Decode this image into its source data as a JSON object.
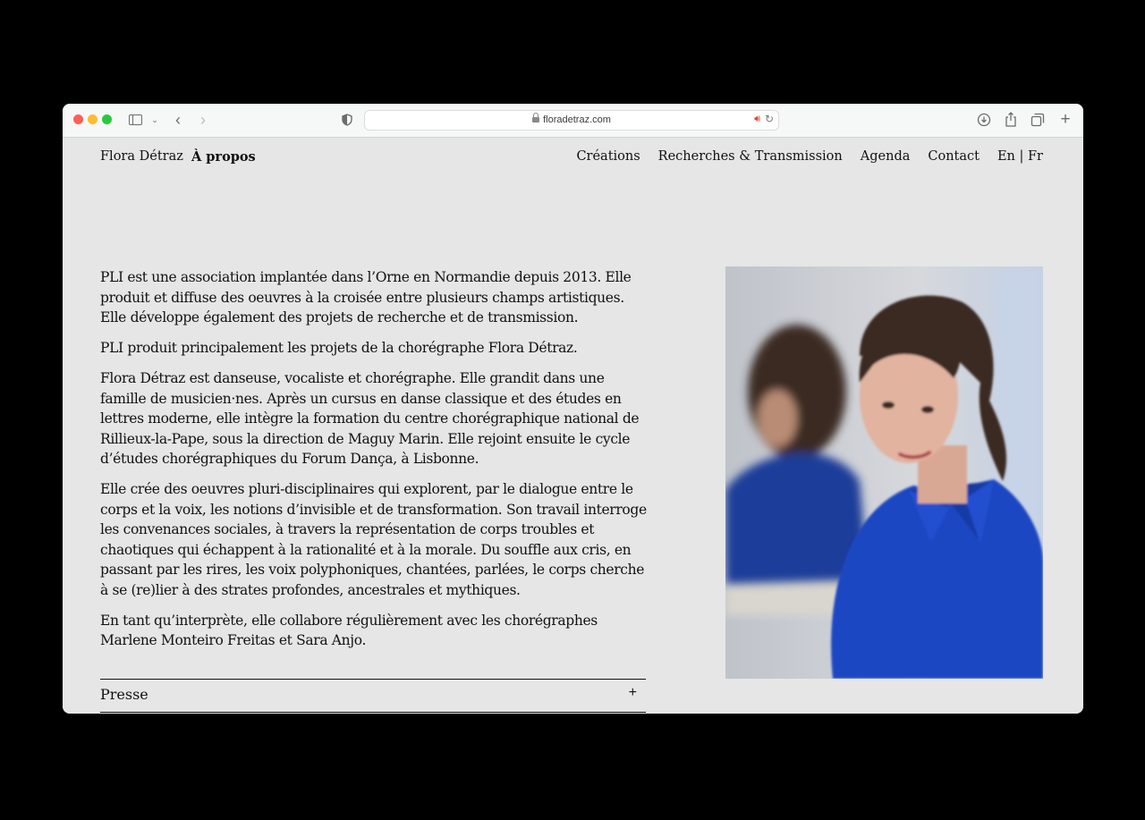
{
  "browser": {
    "url": "floradetraz.com"
  },
  "site": {
    "brand": "Flora Détraz",
    "current_page": "À propos",
    "nav": [
      "Créations",
      "Recherches & Transmission",
      "Agenda",
      "Contact",
      "En | Fr"
    ]
  },
  "content": {
    "paragraphs": [
      "PLI est une association implantée dans l’Orne en Normandie depuis 2013. Elle produit et diffuse des oeuvres à la croisée entre plusieurs champs artistiques. Elle développe également des projets de recherche et de transmission.",
      "PLI produit principalement les projets de la chorégraphe Flora Détraz.",
      "Flora Détraz est danseuse, vocaliste et chorégraphe. Elle grandit dans une famille de musicien·nes. Après un cursus en danse classique et des études en lettres moderne, elle intègre la formation du centre chorégraphique national de Rillieux-la-Pape, sous la direction de Maguy Marin. Elle rejoint ensuite le cycle d’études chorégraphiques du Forum Dança, à Lisbonne.",
      "Elle crée des oeuvres pluri-disciplinaires qui explorent, par le dialogue entre le corps et la voix, les notions d’invisible et de transformation. Son travail interroge les convenances sociales, à travers la représentation de corps troubles et chaotiques qui échappent à la rationalité et à la morale. Du souffle aux cris, en passant par les rires, les voix polyphoniques, chantées, parlées, le corps cherche à se (re)lier à des strates profondes, ancestrales et mythiques.",
      "En tant qu’interprète, elle collabore régulièrement avec les chorégraphes Marlene Monteiro Freitas et Sara Anjo."
    ],
    "accordion": {
      "label": "Presse",
      "toggle": "+"
    }
  },
  "colors": {
    "page_bg": "#e6e6e6",
    "text": "#111111",
    "shirt_blue": "#1c47c2"
  }
}
